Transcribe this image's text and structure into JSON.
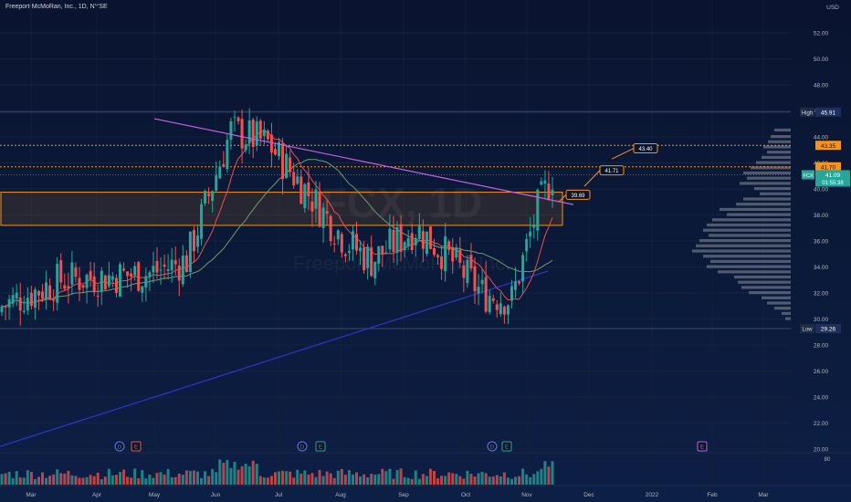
{
  "header": {
    "symbol_title": "Freeport-McMoRan, Inc., 1D, NYSE",
    "currency": "USD"
  },
  "watermark": {
    "ticker_interval": "FCX, 1D",
    "company": "Freeport-McMoRan, Inc."
  },
  "colors": {
    "up": "#26a69a",
    "down": "#ef5350",
    "trendline": "#c261e0",
    "zone": "#f7931a",
    "ma_fast": "#e84e4e",
    "ma_mid": "#6f9b6f",
    "ma_slow": "#2f35c8",
    "profile": "#8a8f9c",
    "price_badge": "#26a69a",
    "axis_text": "#b2b5be"
  },
  "chart_data": {
    "type": "candlestick",
    "instrument": "FCX",
    "interval": "1D",
    "exchange": "NYSE",
    "ylim": [
      20,
      54
    ],
    "y_ticks": [
      20.0,
      22.0,
      24.0,
      26.0,
      28.0,
      30.0,
      32.0,
      34.0,
      36.0,
      38.0,
      40.0,
      42.0,
      44.0,
      46.0,
      48.0,
      50.0,
      52.0
    ],
    "x_ticks": [
      "Mar",
      "Apr",
      "May",
      "Jun",
      "Jul",
      "Aug",
      "Sep",
      "Oct",
      "Nov",
      "Dec",
      "2022",
      "Feb",
      "Mar"
    ],
    "ohlc_anchors": [
      {
        "x": "Feb",
        "close": 31.0
      },
      {
        "x": "Mar",
        "close": 33.0
      },
      {
        "x": "Apr",
        "close": 33.5
      },
      {
        "x": "May",
        "close": 44.5
      },
      {
        "x": "Jun",
        "close": 41.0
      },
      {
        "x": "Jul",
        "close": 36.0
      },
      {
        "x": "Aug",
        "close": 37.0
      },
      {
        "x": "Sep",
        "close": 35.5
      },
      {
        "x": "Oct",
        "close": 32.0
      },
      {
        "x": "Nov",
        "close": 39.0
      },
      {
        "x": "last",
        "close": 41.09
      }
    ],
    "levels": {
      "high": {
        "label": "High",
        "value": "45.91"
      },
      "low": {
        "label": "Low",
        "value": "29.26"
      },
      "l43_35": {
        "value": "43.35"
      },
      "l41_70": {
        "value": "41.70"
      },
      "last": {
        "symbol": "FCX",
        "value": "41.09",
        "countdown": "01:55:38"
      }
    },
    "zone": {
      "from": 37.2,
      "to": 39.75
    },
    "trendline": {
      "from": {
        "x": "May",
        "y": 45.4
      },
      "to": {
        "x": "last",
        "y": 38.8
      }
    },
    "targets": [
      {
        "label": "39.69",
        "value": 39.69
      },
      {
        "label": "41.71",
        "value": 41.71
      },
      {
        "label": "43.40",
        "value": 43.4
      }
    ],
    "event_markers": [
      {
        "x": "Apr",
        "label": "D"
      },
      {
        "x": "Apr",
        "label": "E"
      },
      {
        "x": "Jul",
        "label": "D"
      },
      {
        "x": "Jul",
        "label": "E"
      },
      {
        "x": "Oct",
        "label": "D"
      },
      {
        "x": "Oct",
        "label": "E"
      },
      {
        "x": "2022",
        "label": "E"
      }
    ],
    "volume_panel_label": "80"
  }
}
